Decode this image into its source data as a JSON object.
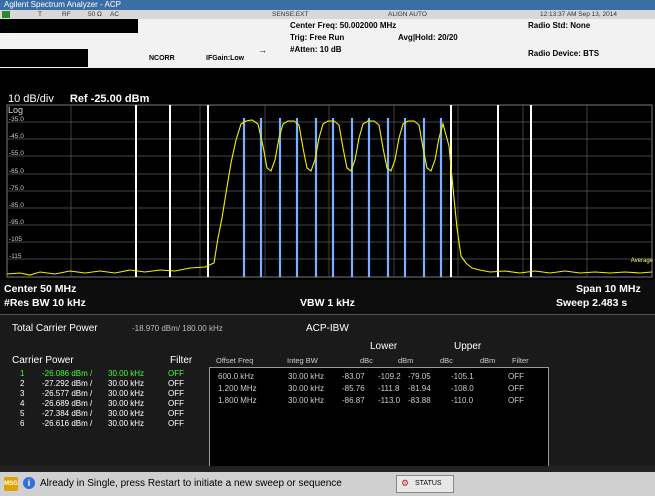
{
  "title": "Agilent Spectrum Analyzer - ACP",
  "status_row": {
    "t": "T",
    "rf": "RF",
    "imp": "50 Ω",
    "ac": "AC",
    "sense": "SENSE:EXT",
    "align": "ALIGN AUTO",
    "datetime": "12:13:37 AM Sep 13, 2014"
  },
  "header": {
    "ncorr": "NCORR",
    "ifgain": "IFGain:Low",
    "center_freq": "Center Freq: 50.002000 MHz",
    "trig": "Trig: Free Run",
    "atten": "#Atten: 10 dB",
    "avg_hold": "Avg|Hold: 20/20",
    "radio_std": "Radio Std: None",
    "radio_device": "Radio Device: BTS"
  },
  "plot": {
    "scale": "10 dB/div",
    "ref": "Ref -25.00 dBm",
    "log": "Log",
    "yticks": [
      "-35.0",
      "-45.0",
      "-55.0",
      "-65.0",
      "-75.0",
      "-85.0",
      "-95.0",
      "-105",
      "-115"
    ],
    "avg_label": "Average"
  },
  "footer": {
    "center": "Center  50 MHz",
    "res_bw": "#Res BW  10 kHz",
    "vbw": "VBW  1 kHz",
    "span": "Span 10 MHz",
    "sweep": "Sweep  2.483 s"
  },
  "measurement": {
    "total_carrier_power_label": "Total Carrier Power",
    "total_carrier_power_value": "-18.970 dBm/ 180.00 kHz",
    "mode": "ACP-IBW",
    "carrier_power_label": "Carrier Power",
    "filter_label": "Filter",
    "carriers": [
      {
        "n": "1",
        "power": "-26.086 dBm /",
        "bw": "30.00 kHz",
        "filter": "OFF"
      },
      {
        "n": "2",
        "power": "-27.292 dBm /",
        "bw": "30.00 kHz",
        "filter": "OFF"
      },
      {
        "n": "3",
        "power": "-26.577 dBm /",
        "bw": "30.00 kHz",
        "filter": "OFF"
      },
      {
        "n": "4",
        "power": "-26.689 dBm /",
        "bw": "30.00 kHz",
        "filter": "OFF"
      },
      {
        "n": "5",
        "power": "-27.384 dBm /",
        "bw": "30.00 kHz",
        "filter": "OFF"
      },
      {
        "n": "6",
        "power": "-26.616 dBm /",
        "bw": "30.00 kHz",
        "filter": "OFF"
      }
    ],
    "table": {
      "lower": "Lower",
      "upper": "Upper",
      "headers": [
        "Offset Freq",
        "Integ BW",
        "dBc",
        "dBm",
        "dBc",
        "dBm",
        "Filter"
      ],
      "rows": [
        [
          "600.0 kHz",
          "30.00 kHz",
          "-83.07",
          "-109.2",
          "-79.05",
          "-105.1",
          "OFF"
        ],
        [
          "1.200 MHz",
          "30.00 kHz",
          "-85.76",
          "-111.8",
          "-81.94",
          "-108.0",
          "OFF"
        ],
        [
          "1.800 MHz",
          "30.00 kHz",
          "-86.87",
          "-113.0",
          "-83.88",
          "-110.0",
          "OFF"
        ]
      ]
    }
  },
  "bottom": {
    "msg": "MSG",
    "info": "i",
    "message": "Already in Single, press Restart to initiate a new sweep or sequence",
    "status": "STATUS"
  }
}
